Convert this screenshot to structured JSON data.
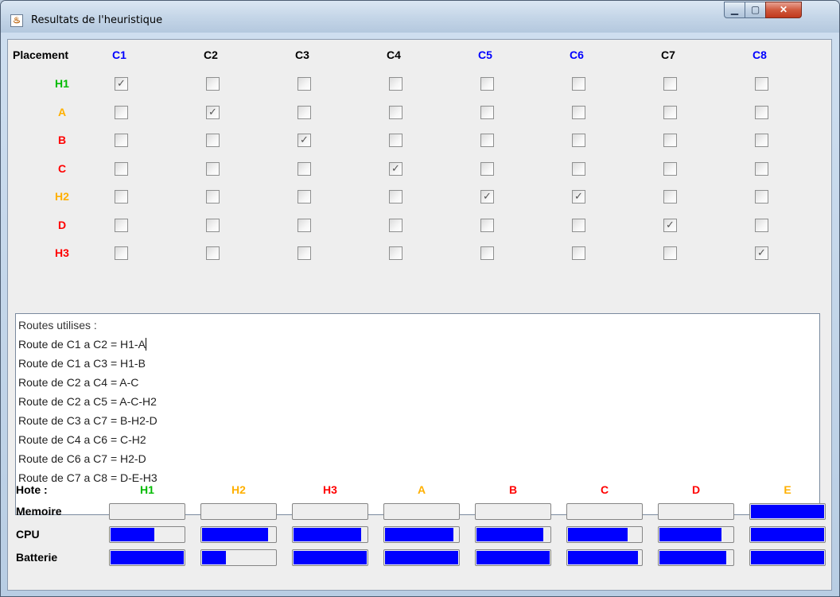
{
  "window": {
    "title": "Resultats de l'heuristique",
    "icon": "java-cup-icon",
    "buttons": [
      "minimize-icon",
      "maximize-icon",
      "close-icon"
    ]
  },
  "placement": {
    "header_label": "Placement",
    "columns": [
      {
        "label": "C1",
        "color": "#0000ff"
      },
      {
        "label": "C2",
        "color": "#000000"
      },
      {
        "label": "C3",
        "color": "#000000"
      },
      {
        "label": "C4",
        "color": "#000000"
      },
      {
        "label": "C5",
        "color": "#0000ff"
      },
      {
        "label": "C6",
        "color": "#0000ff"
      },
      {
        "label": "C7",
        "color": "#000000"
      },
      {
        "label": "C8",
        "color": "#0000ff"
      }
    ],
    "rows": [
      {
        "label": "H1",
        "color": "#00bb00",
        "checked": [
          0
        ]
      },
      {
        "label": "A",
        "color": "#ffb000",
        "checked": [
          1
        ]
      },
      {
        "label": "B",
        "color": "#ff0000",
        "checked": [
          2
        ]
      },
      {
        "label": "C",
        "color": "#ff0000",
        "checked": [
          3
        ]
      },
      {
        "label": "H2",
        "color": "#ffb000",
        "checked": [
          4,
          5
        ]
      },
      {
        "label": "D",
        "color": "#ff0000",
        "checked": [
          6
        ]
      },
      {
        "label": "H3",
        "color": "#ff0000",
        "checked": [
          7
        ]
      }
    ]
  },
  "routes": {
    "heading": "Routes utilises :",
    "lines": [
      "Route de C1 a C2 = H1-A",
      "Route de C1 a C3 = H1-B",
      "Route de C2 a C4 = A-C",
      "Route de C2 a C5 = A-C-H2",
      "Route de C3 a C7 = B-H2-D",
      "Route de C4 a C6 = C-H2",
      "Route de C6 a C7 = H2-D",
      "Route de C7 a C8 = D-E-H3"
    ]
  },
  "resources": {
    "header_label": "Hote :",
    "hosts": [
      {
        "label": "H1",
        "color": "#00bb00"
      },
      {
        "label": "H2",
        "color": "#ffb000"
      },
      {
        "label": "H3",
        "color": "#ff0000"
      },
      {
        "label": "A",
        "color": "#ffb000"
      },
      {
        "label": "B",
        "color": "#ff0000"
      },
      {
        "label": "C",
        "color": "#ff0000"
      },
      {
        "label": "D",
        "color": "#ff0000"
      },
      {
        "label": "E",
        "color": "#ffb000"
      }
    ],
    "rows": [
      {
        "label": "Memoire",
        "values": [
          0,
          0,
          0,
          0,
          0,
          0,
          0,
          1
        ]
      },
      {
        "label": "CPU",
        "values": [
          0.6,
          0.9,
          0.92,
          0.93,
          0.91,
          0.82,
          0.85,
          1
        ]
      },
      {
        "label": "Batterie",
        "values": [
          1,
          0.33,
          1,
          1,
          1,
          0.96,
          0.91,
          1
        ]
      }
    ],
    "fill_color": "#0000ff"
  }
}
